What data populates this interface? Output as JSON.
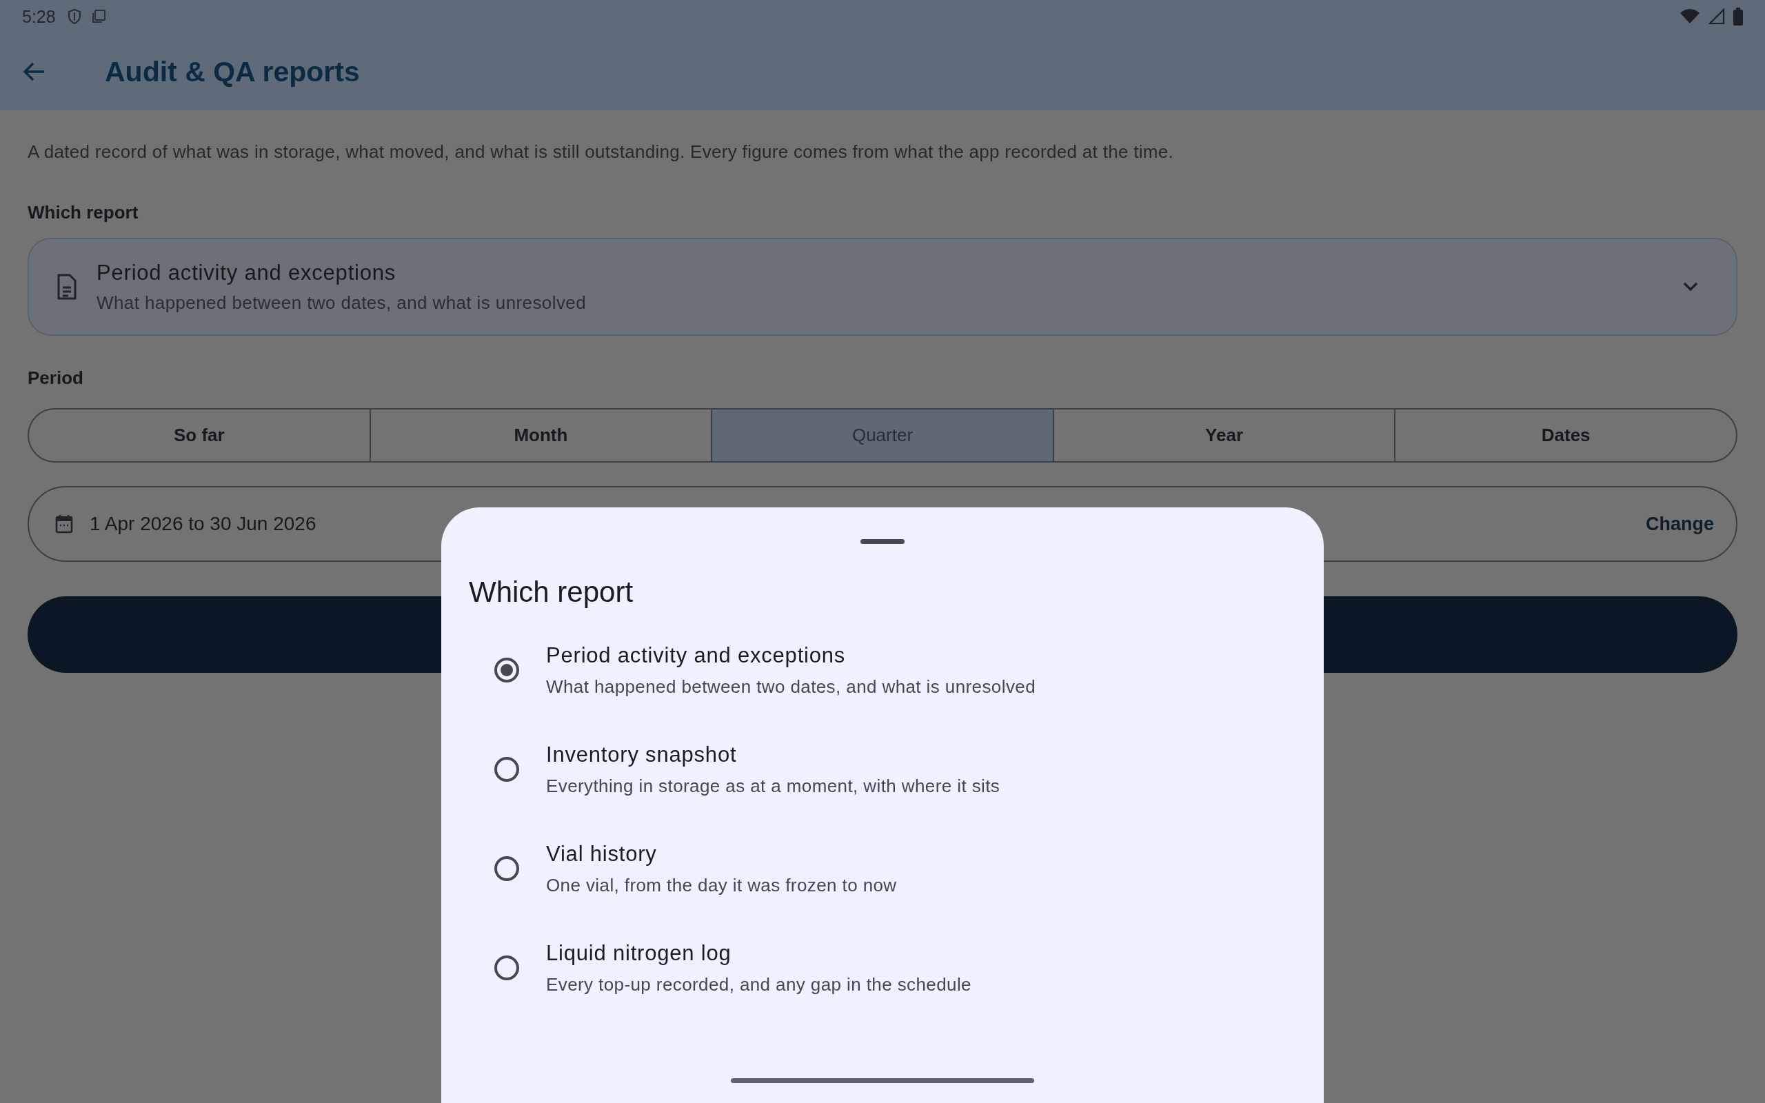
{
  "status_bar": {
    "time": "5:28"
  },
  "app_bar": {
    "title": "Audit & QA reports"
  },
  "description": "A dated record of what was in storage, what moved, and what is still outstanding. Every figure comes from what the app recorded at the time.",
  "report_field": {
    "label": "Which report",
    "title": "Period activity and exceptions",
    "subtitle": "What happened between two dates, and what is unresolved"
  },
  "period": {
    "label": "Period",
    "segments": [
      {
        "label": "So far",
        "selected": false
      },
      {
        "label": "Month",
        "selected": false
      },
      {
        "label": "Quarter",
        "selected": true
      },
      {
        "label": "Year",
        "selected": false
      },
      {
        "label": "Dates",
        "selected": false
      }
    ]
  },
  "date_range": {
    "value": "1 Apr 2026 to 30 Jun 2026",
    "action": "Change"
  },
  "sheet": {
    "title": "Which report",
    "options": [
      {
        "title": "Period activity and exceptions",
        "subtitle": "What happened between two dates, and what is unresolved",
        "selected": true
      },
      {
        "title": "Inventory snapshot",
        "subtitle": "Everything in storage as at a moment, with where it sits",
        "selected": false
      },
      {
        "title": "Vial history",
        "subtitle": "One vial, from the day it was frozen to now",
        "selected": false
      },
      {
        "title": "Liquid nitrogen log",
        "subtitle": "Every top-up recorded, and any gap in the schedule",
        "selected": false
      }
    ]
  }
}
